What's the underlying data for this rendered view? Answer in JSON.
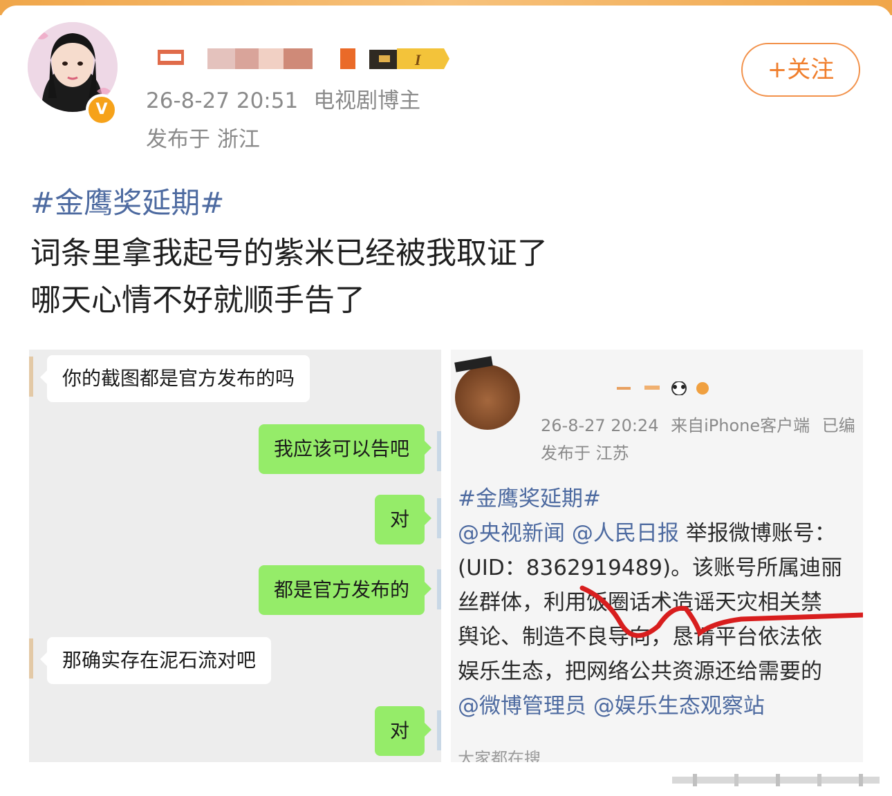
{
  "colors": {
    "accent": "#f07e2c",
    "link": "#4d6aa0",
    "chat_out": "#95ec69",
    "chat_bg": "#ededed",
    "verified_badge": "#f6a21a"
  },
  "post": {
    "avatar_icon": "user-avatar-icon",
    "verified_badge": "V",
    "time": "26-8-27 20:51",
    "source": "电视剧博主",
    "location": "发布于 浙江",
    "follow_label": "+关注",
    "hashtag": "#金鹰奖延期#",
    "lines": [
      "词条里拿我起号的紫米已经被我取证了",
      "哪天心情不好就顺手告了"
    ]
  },
  "chat": {
    "messages": [
      {
        "side": "in",
        "text": "你的截图都是官方发布的吗"
      },
      {
        "side": "out",
        "text": "我应该可以告吧"
      },
      {
        "side": "out",
        "text": "对"
      },
      {
        "side": "out",
        "text": "都是官方发布的"
      },
      {
        "side": "in",
        "text": "那确实存在泥石流对吧"
      },
      {
        "side": "out",
        "text": "对"
      }
    ]
  },
  "embedded_post": {
    "time": "26-8-27 20:24",
    "source": "来自iPhone客户端",
    "extra": "已编",
    "location": "发布于 江苏",
    "hashtag": "#金鹰奖延期#",
    "mention1": "@央视新闻",
    "mention2": "@人民日报",
    "line1_rest": "举报微博账号：",
    "line2": "(UID：8362919489)。该账号所属迪丽",
    "line3": "丝群体，利用饭圈话术造谣天灾相关禁",
    "line4": "舆论、制造不良导向，恳请平台依法依",
    "line5": "娱乐生态，把网络公共资源还给需要的",
    "mention3": "@微博管理员",
    "mention4": "@娱乐生态观察站",
    "search_hint": "大家都在搜"
  }
}
